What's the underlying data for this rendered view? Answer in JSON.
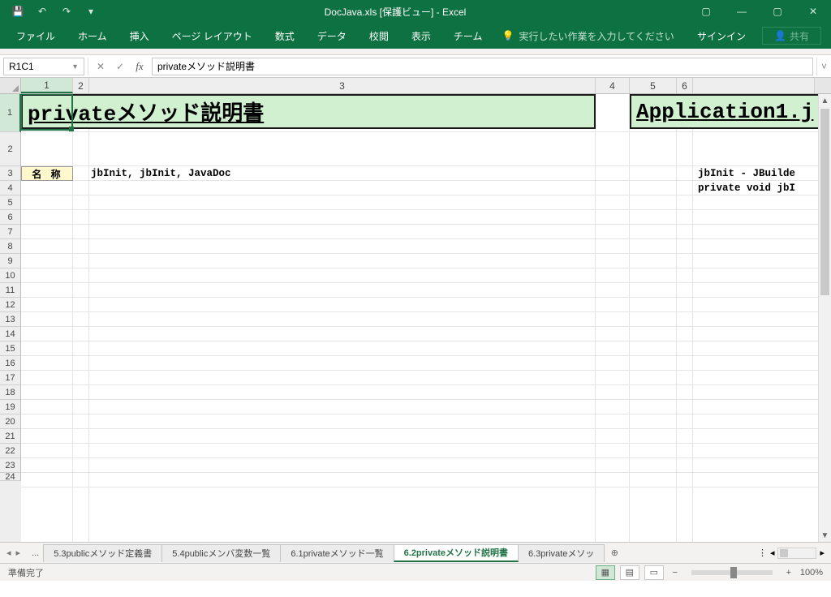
{
  "titlebar": {
    "title": "DocJava.xls  [保護ビュー] - Excel"
  },
  "window_controls": {
    "ribbon_opts": "▢",
    "minimize": "—",
    "maximize": "▢",
    "close": "✕"
  },
  "qat": {
    "save": "💾",
    "undo": "↶",
    "redo": "↷",
    "custom": "▾"
  },
  "ribbon": {
    "file": "ファイル",
    "home": "ホーム",
    "insert": "挿入",
    "page_layout": "ページ レイアウト",
    "formulas": "数式",
    "data": "データ",
    "review": "校閲",
    "view": "表示",
    "team": "チーム",
    "tellme_icon": "💡",
    "tellme": "実行したい作業を入力してください",
    "signin": "サインイン",
    "share_icon": "👤",
    "share": "共有"
  },
  "formula": {
    "name_box": "R1C1",
    "cancel": "✕",
    "enter": "✓",
    "fx": "fx",
    "content": "privateメソッド説明書",
    "expand": "˅"
  },
  "columns": [
    "1",
    "2",
    "3",
    "4",
    "5",
    "6"
  ],
  "rows": [
    "1",
    "2",
    "3",
    "4",
    "5",
    "6",
    "7",
    "8",
    "9",
    "10",
    "11",
    "12",
    "13",
    "14",
    "15",
    "16",
    "17",
    "18",
    "19",
    "20",
    "21",
    "22",
    "23",
    "24"
  ],
  "cells": {
    "big_left": "privateメソッド説明書",
    "big_right": "Application1.j",
    "label": "名 称",
    "r3c3": "jbInit, jbInit, JavaDoc",
    "r3right": "jbInit - JBuilde",
    "r4right": "private void jbI"
  },
  "sheet_tabs": {
    "nav_first": "◂",
    "nav_prev": "▸",
    "ellipsis": "...",
    "tabs": [
      {
        "label": "5.3publicメソッド定義書"
      },
      {
        "label": "5.4publicメンバ変数一覧"
      },
      {
        "label": "6.1privateメソッド一覧"
      },
      {
        "label": "6.2privateメソッド説明書"
      },
      {
        "label": "6.3privateメソッ"
      }
    ],
    "active_index": 3,
    "add": "⊕",
    "more": "⋮",
    "hleft": "◂",
    "hright": "▸"
  },
  "status": {
    "ready": "準備完了",
    "view_normal": "▦",
    "view_layout": "▤",
    "view_break": "▭",
    "zoom_minus": "−",
    "zoom_plus": "+",
    "zoom_pct": "100%"
  }
}
